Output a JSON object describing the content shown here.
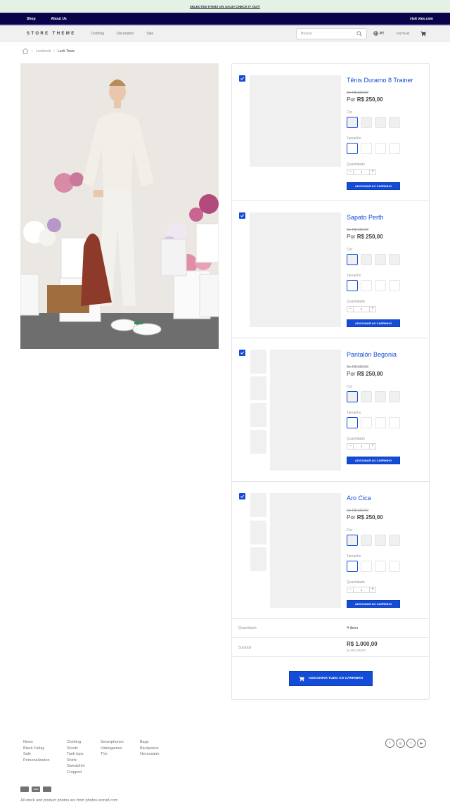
{
  "promo": {
    "text": "SELECTED ITEMS ON SALE! CHECK IT OUT!"
  },
  "topnav": {
    "links": [
      "Shop",
      "About Us"
    ],
    "right_link": "visit vtex.com"
  },
  "header": {
    "logo": "STORE THEME",
    "menu": [
      "Clothing",
      "Decoration",
      "Sale"
    ],
    "search": {
      "placeholder": "Buscar",
      "icon": "search-icon"
    },
    "language": "PT",
    "login": "ENTRAR",
    "cart_icon": "cart-icon"
  },
  "breadcrumb": {
    "home_icon": "home-icon",
    "items": [
      "Lookbook",
      "Look Teste"
    ]
  },
  "look": {
    "image_alt": "woman in white outfit among flower buckets"
  },
  "products": [
    {
      "name": "Tênis Duramo 8 Trainer",
      "list_price": "De R$ 330,00",
      "sell_prefix": "Por",
      "sell_price": "R$ 250,00",
      "color_label": "Cor",
      "size_label": "Tamanho",
      "qty_label": "Quantidade",
      "qty": "1",
      "add_label": "ADICIONAR AO CARRINHO"
    },
    {
      "name": "Sapato Perth",
      "list_price": "De R$ 330,00",
      "sell_prefix": "Por",
      "sell_price": "R$ 250,00",
      "color_label": "Cor",
      "size_label": "Tamanho",
      "qty_label": "Quantidade",
      "qty": "1",
      "add_label": "ADICIONAR AO CARRINHO"
    },
    {
      "name": "Pantalón Begonia",
      "list_price": "De R$ 330,00",
      "sell_prefix": "Por",
      "sell_price": "R$ 250,00",
      "color_label": "Cor",
      "size_label": "Tamanho",
      "qty_label": "Quantidade",
      "qty": "1",
      "add_label": "ADICIONAR AO CARRINHO"
    },
    {
      "name": "Aro Cica",
      "list_price": "De R$ 330,00",
      "sell_prefix": "Por",
      "sell_price": "R$ 250,00",
      "color_label": "Cor",
      "size_label": "Tamanho",
      "qty_label": "Quantidade",
      "qty": "1",
      "add_label": "ADICIONAR AO CARRINHO"
    }
  ],
  "summary": {
    "qty_label": "Quantidade",
    "qty_value": "4 itens",
    "subtotal_label": "Subtotal",
    "subtotal_value": "R$ 1.000,00",
    "installments": "5x R$ 200,00",
    "add_all_label": "ADICIONAR TUDO AO CARRINHO"
  },
  "footer": {
    "col1": [
      "News",
      "Black Friday",
      "Sale",
      "Personalization"
    ],
    "col2": [
      "Clothing",
      "Shorts",
      "Tank tops",
      "Shirts",
      "Sweatshirt",
      "Cropped"
    ],
    "col3": [
      "Smartphones",
      "Videogames",
      "TVs"
    ],
    "col4": [
      "Bags",
      "Backpacks",
      "Necessaire"
    ],
    "social_icons": [
      "facebook-icon",
      "instagram-icon",
      "twitter-icon",
      "youtube-icon"
    ],
    "payment_icons": [
      "mastercard-icon",
      "visa-icon",
      "diners-icon"
    ],
    "payment_labels": [
      "",
      "VISA",
      ""
    ],
    "credits": "All stock and product photos are from photos.icons8.com"
  },
  "colors": {
    "brand_blue": "#134cd8",
    "topnav_bg": "#0a034a",
    "promo_bg": "#e6f1e6"
  }
}
